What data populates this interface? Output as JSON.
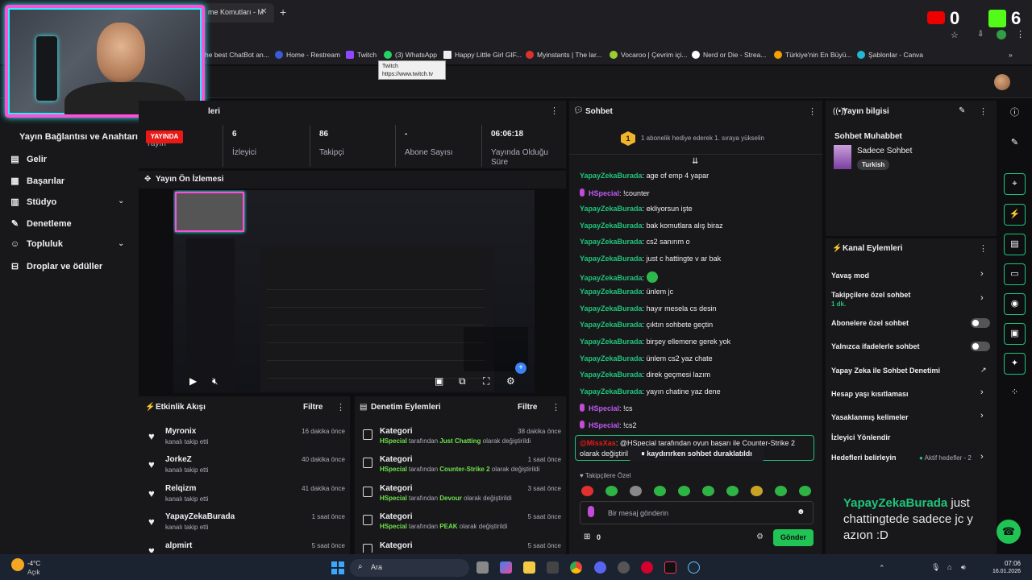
{
  "browser": {
    "active_tab": "me Komutları - M",
    "tooltip_title": "Twitch",
    "tooltip_url": "https://www.twitch.tv",
    "bookmarks": [
      {
        "label": "he best ChatBot an...",
        "color": "#333"
      },
      {
        "label": "Home - Restream",
        "color": "#3b5bdb"
      },
      {
        "label": "Twitch",
        "color": "#9147ff"
      },
      {
        "label": "(3) WhatsApp",
        "color": "#25d366"
      },
      {
        "label": "Happy Little Girl GIF...",
        "color": "#eee"
      },
      {
        "label": "Myinstants | The lar...",
        "color": "#e03131"
      },
      {
        "label": "Vocaroo | Çevrim içi...",
        "color": "#9acd32"
      },
      {
        "label": "Nerd or Die - Strea...",
        "color": "#fff"
      },
      {
        "label": "Türkiye'nin En Büyü...",
        "color": "#f59f00"
      },
      {
        "label": "Şablonlar - Canva",
        "color": "#22b8cf"
      }
    ],
    "overlay_counts": {
      "youtube": "0",
      "kick": "6"
    }
  },
  "nav": {
    "section_label": "Yayın Bağlantısı ve Anahtarı",
    "items": [
      {
        "label": "Gelir"
      },
      {
        "label": "Başarılar"
      },
      {
        "label": "Stüdyo"
      },
      {
        "label": "Denetleme"
      },
      {
        "label": "Topluluk"
      },
      {
        "label": "Droplar ve ödüller"
      }
    ]
  },
  "stats": {
    "title": "leri",
    "live_badge": "YAYINDA",
    "items": [
      {
        "value": "",
        "label": "Yayın"
      },
      {
        "value": "6",
        "label": "İzleyici"
      },
      {
        "value": "86",
        "label": "Takipçi"
      },
      {
        "value": "-",
        "label": "Abone Sayısı"
      },
      {
        "value": "06:06:18",
        "label": "Yayında Olduğu Süre"
      }
    ]
  },
  "preview": {
    "title": "Yayın Ön İzlemesi"
  },
  "activity": {
    "title": "Etkinlik Akışı",
    "filter": "Filtre",
    "items": [
      {
        "name": "Myronix",
        "sub": "kanalı takip etti",
        "time": "16 dakika önce"
      },
      {
        "name": "JorkeZ",
        "sub": "kanalı takip etti",
        "time": "40 dakika önce"
      },
      {
        "name": "Relqizm",
        "sub": "kanalı takip etti",
        "time": "41 dakika önce"
      },
      {
        "name": "YapayZekaBurada",
        "sub": "kanalı takip etti",
        "time": "1 saat önce"
      },
      {
        "name": "alpmirt",
        "sub": "",
        "time": "5 saat önce"
      }
    ]
  },
  "modlog": {
    "title": "Denetim Eylemleri",
    "filter": "Filtre",
    "items": [
      {
        "name": "Kategori",
        "user": "HSpecial",
        "mid": " tarafından ",
        "value": "Just Chatting",
        "end": " olarak değiştirildi",
        "time": "38 dakika önce"
      },
      {
        "name": "Kategori",
        "user": "HSpecial",
        "mid": " tarafından ",
        "value": "Counter-Strike 2",
        "end": " olarak değiştirildi",
        "time": "1 saat önce"
      },
      {
        "name": "Kategori",
        "user": "HSpecial",
        "mid": " tarafından ",
        "value": "Devour",
        "end": " olarak değiştirildi",
        "time": "3 saat önce"
      },
      {
        "name": "Kategori",
        "user": "HSpecial",
        "mid": " tarafından ",
        "value": "PEAK",
        "end": " olarak değiştirildi",
        "time": "5 saat önce"
      },
      {
        "name": "Kategori",
        "user": "",
        "mid": "",
        "value": "",
        "end": "",
        "time": "5 saat önce"
      }
    ]
  },
  "chat": {
    "title": "Sohbet",
    "banner_num": "1",
    "banner_text": "1 abonelik hediye ederek 1. sıraya yükselin",
    "messages": [
      {
        "user": "YapayZekaBurada",
        "text": "age of emp 4 yapar",
        "mod": false
      },
      {
        "user": "HSpecial",
        "text": "!counter",
        "mod": true
      },
      {
        "user": "YapayZekaBurada",
        "text": "ekliyorsun işte",
        "mod": false
      },
      {
        "user": "YapayZekaBurada",
        "text": "bak komutlara alış biraz",
        "mod": false
      },
      {
        "user": "YapayZekaBurada",
        "text": "cs2 sanırım o",
        "mod": false
      },
      {
        "user": "YapayZekaBurada",
        "text": "just c hattingte v ar bak",
        "mod": false
      },
      {
        "user": "YapayZekaBurada",
        "text": "",
        "mod": false
      },
      {
        "user": "YapayZekaBurada",
        "text": "ünlem jc",
        "mod": false
      },
      {
        "user": "YapayZekaBurada",
        "text": "hayır mesela cs desin",
        "mod": false
      },
      {
        "user": "YapayZekaBurada",
        "text": "çıktın sohbete geçtin",
        "mod": false
      },
      {
        "user": "YapayZekaBurada",
        "text": "birşey ellemene gerek yok",
        "mod": false
      },
      {
        "user": "YapayZekaBurada",
        "text": "ünlem cs2 yaz chate",
        "mod": false
      },
      {
        "user": "YapayZekaBurada",
        "text": "direk geçmesi lazım",
        "mod": false
      },
      {
        "user": "YapayZekaBurada",
        "text": "yayın chatine yaz dene",
        "mod": false
      },
      {
        "user": "HSpecial",
        "text": "!cs",
        "mod": true
      },
      {
        "user": "HSpecial",
        "text": "!cs2",
        "mod": true
      }
    ],
    "highlight_user": "@MissXas",
    "highlight_text": ": @HSpecial tarafından oyun başarı ile Counter-Strike 2 olarak değiştiril",
    "paused": "kaydırırken sohbet duraklatıldı",
    "followers_only": "Takipçilere Özel",
    "input_placeholder": "Bir mesaj gönderin",
    "points": "0",
    "send": "Gönder"
  },
  "stream_info": {
    "title": "Yayın bilgisi",
    "stream_title": "Sohbet Muhabbet",
    "category": "Sadece Sohbet",
    "tag": "Turkish"
  },
  "channel_actions": {
    "title": "Kanal Eylemleri",
    "items": [
      {
        "label": "Yavaş mod",
        "control": "chevron"
      },
      {
        "label": "Takipçilere özel sohbet",
        "sub": "1 dk.",
        "control": "chevron"
      },
      {
        "label": "Abonelere özel sohbet",
        "control": "toggle"
      },
      {
        "label": "Yalnızca ifadelerle sohbet",
        "control": "toggle"
      },
      {
        "label": "Yapay Zeka ile Sohbet Denetimi",
        "control": "external"
      },
      {
        "label": "Hesap yaşı kısıtlaması",
        "control": "chevron"
      },
      {
        "label": "Yasaklanmış kelimeler",
        "control": "chevron"
      },
      {
        "label": "İzleyici Yönlendir",
        "control": "none"
      },
      {
        "label": "Hedefleri belirleyin",
        "control": "chevron",
        "extra": "Aktif hedefler - 2"
      }
    ]
  },
  "overlay": {
    "user": "YapayZekaBurada",
    "text": "just chattingtede sadece jc y azıon :D"
  },
  "taskbar": {
    "weather_temp": "-4°C",
    "weather_desc": "Açık",
    "search": "Ara",
    "time": "07:06",
    "date": "16.01.2026"
  },
  "colors": {
    "accent": "#1fc47a",
    "live": "#e91916",
    "brand": "#9147ff"
  }
}
